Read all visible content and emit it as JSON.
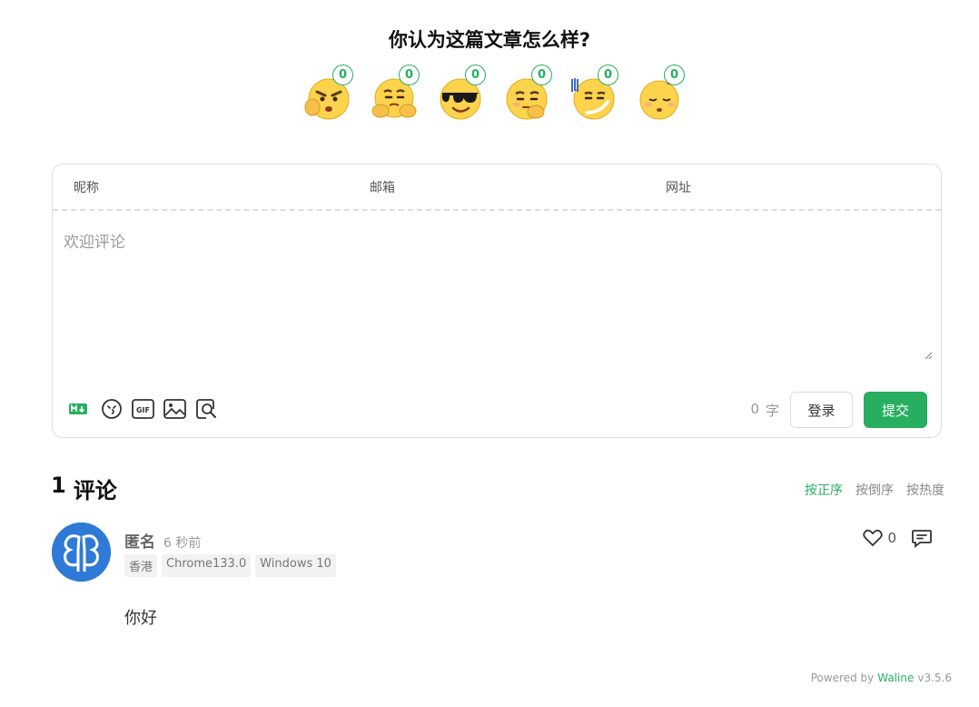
{
  "reaction": {
    "title": "你认为这篇文章怎么样?",
    "items": [
      {
        "icon": "angry-emoji-icon",
        "count": "0"
      },
      {
        "icon": "shrug-emoji-icon",
        "count": "0"
      },
      {
        "icon": "cool-sunglasses-emoji-icon",
        "count": "0"
      },
      {
        "icon": "thinking-emoji-icon",
        "count": "0"
      },
      {
        "icon": "awkward-emoji-icon",
        "count": "0"
      },
      {
        "icon": "sleepy-emoji-icon",
        "count": "0"
      }
    ]
  },
  "form": {
    "nick_label": "昵称",
    "mail_label": "邮箱",
    "link_label": "网址",
    "editor_placeholder": "欢迎评论",
    "word_count": "0",
    "word_unit": "字",
    "login_label": "登录",
    "submit_label": "提交",
    "tools": [
      "markdown-icon",
      "emoji-icon",
      "gif-icon",
      "image-icon",
      "preview-icon"
    ],
    "accent": "#27ae60"
  },
  "comments": {
    "count": "1",
    "count_label": "评论",
    "sort": [
      "按正序",
      "按倒序",
      "按热度"
    ],
    "items": [
      {
        "nick": "匿名",
        "time": "6 秒前",
        "tags": [
          "香港",
          "Chrome133.0",
          "Windows 10"
        ],
        "likes": "0",
        "content": "你好",
        "avatar_color": "#2f7ad6"
      }
    ]
  },
  "footer": {
    "prefix": "Powered by",
    "brand": "Waline",
    "version": "v3.5.6"
  }
}
